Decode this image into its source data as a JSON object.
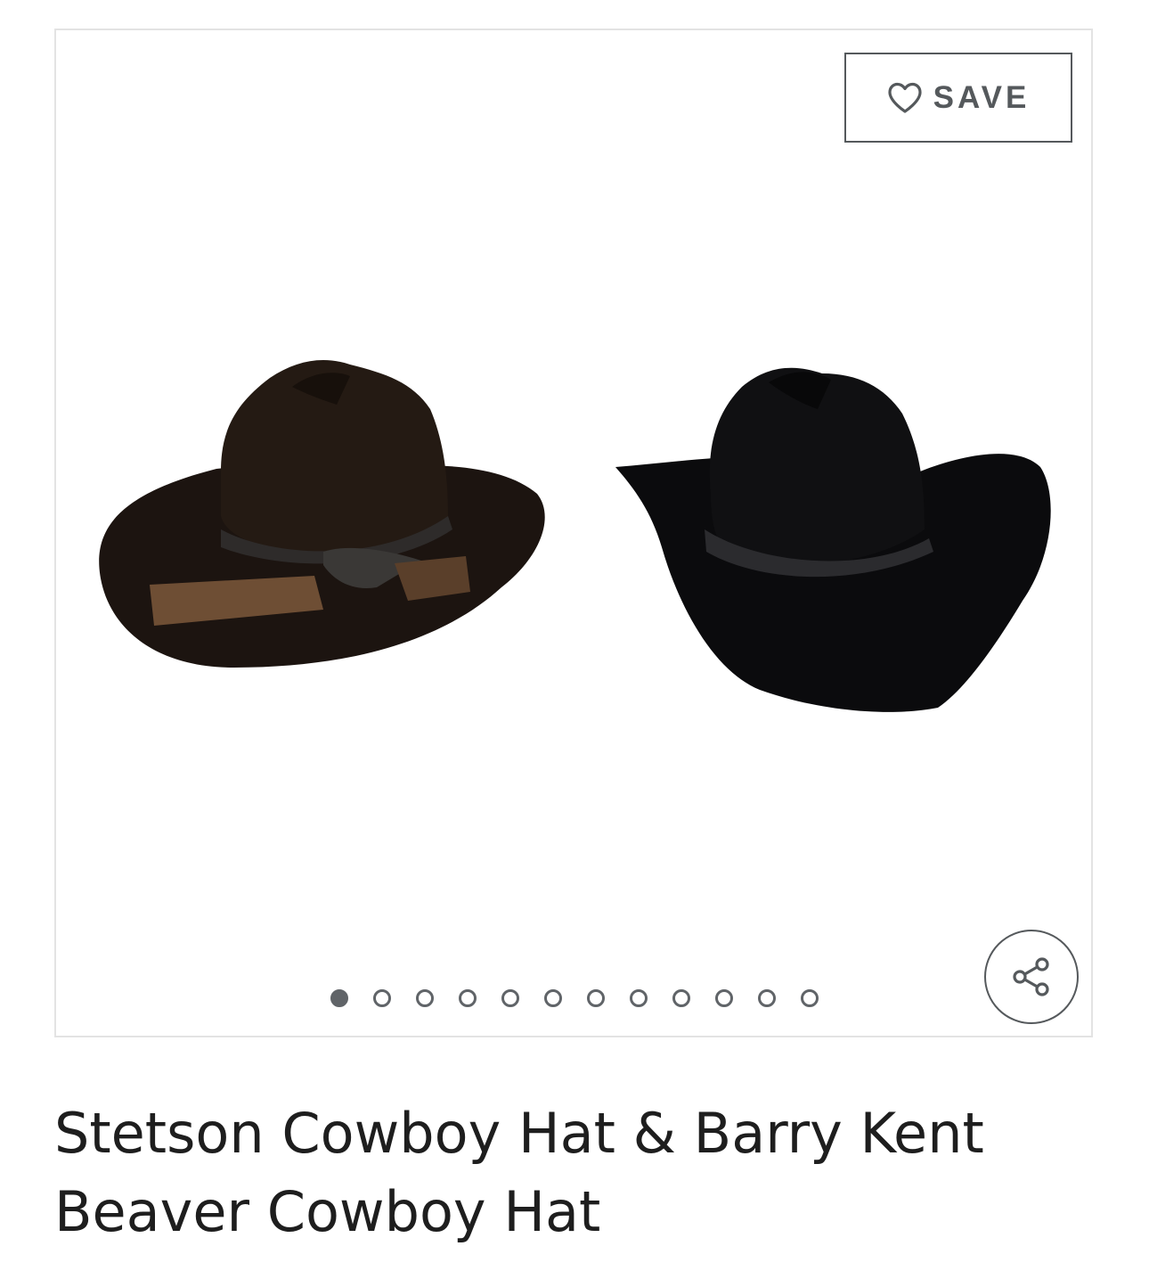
{
  "product": {
    "title": "Stetson Cowboy Hat & Barry Kent Beaver Cowboy Hat"
  },
  "gallery": {
    "save_label": "SAVE",
    "save_icon": "heart-outline-icon",
    "share_icon": "share-icon",
    "image_count": 12,
    "active_index": 0,
    "image_description_hidden": ""
  },
  "colors": {
    "text": "#1e1e1e",
    "control": "#55595c",
    "border": "#e3e3e3",
    "dot_active": "#606468"
  }
}
